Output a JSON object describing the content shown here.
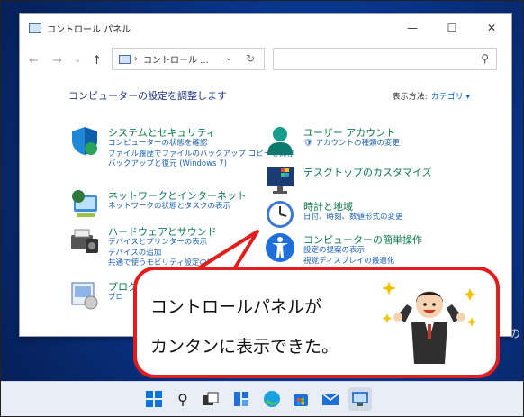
{
  "window": {
    "title": "コントロール パネル",
    "minimize": "—",
    "maximize": "☐",
    "close": "✕"
  },
  "nav": {
    "back": "←",
    "forward": "→",
    "dropdown": "⌄",
    "up": "↑",
    "address_sep": "›",
    "address_text": "コントロール ...",
    "address_dropdown": "⌄",
    "refresh": "↻"
  },
  "heading": "コンピューターの設定を調整します",
  "view_by": {
    "label": "表示方法:",
    "value": "カテゴリ ▾"
  },
  "categories": [
    {
      "title": "システムとセキュリティ",
      "links": [
        "コンピューターの状態を確認",
        "ファイル履歴でファイルのバックアップ コピーを保存",
        "バックアップと復元 (Windows 7)"
      ]
    },
    {
      "title": "ネットワークとインターネット",
      "links": [
        "ネットワークの状態とタスクの表示"
      ]
    },
    {
      "title": "ハードウェアとサウンド",
      "links": [
        "デバイスとプリンターの表示",
        "デバイスの追加",
        "共通で使うモビリティ設定の調整"
      ]
    },
    {
      "title": "プログ",
      "links": [
        "プロ"
      ]
    },
    {
      "title": "ユーザー アカウント",
      "links": [
        "アカウントの種類の変更"
      ]
    },
    {
      "title": "デスクトップのカスタマイズ",
      "links": []
    },
    {
      "title": "時計と地域",
      "links": [
        "日付、時刻、数値形式の変更"
      ]
    },
    {
      "title": "コンピューターの簡単操作",
      "links": [
        "設定の提案の表示",
        "視覚ディスプレイの最適化"
      ]
    }
  ],
  "bubble": {
    "line1": "コントロールパネルが",
    "line2": "カンタンに表示できた。"
  },
  "desktop_glyph": "の",
  "colors": {
    "accent_red": "#e01e1e",
    "category_green": "#0b7a4a",
    "link_blue": "#1a5fb4",
    "heading_blue": "#1e3287"
  }
}
